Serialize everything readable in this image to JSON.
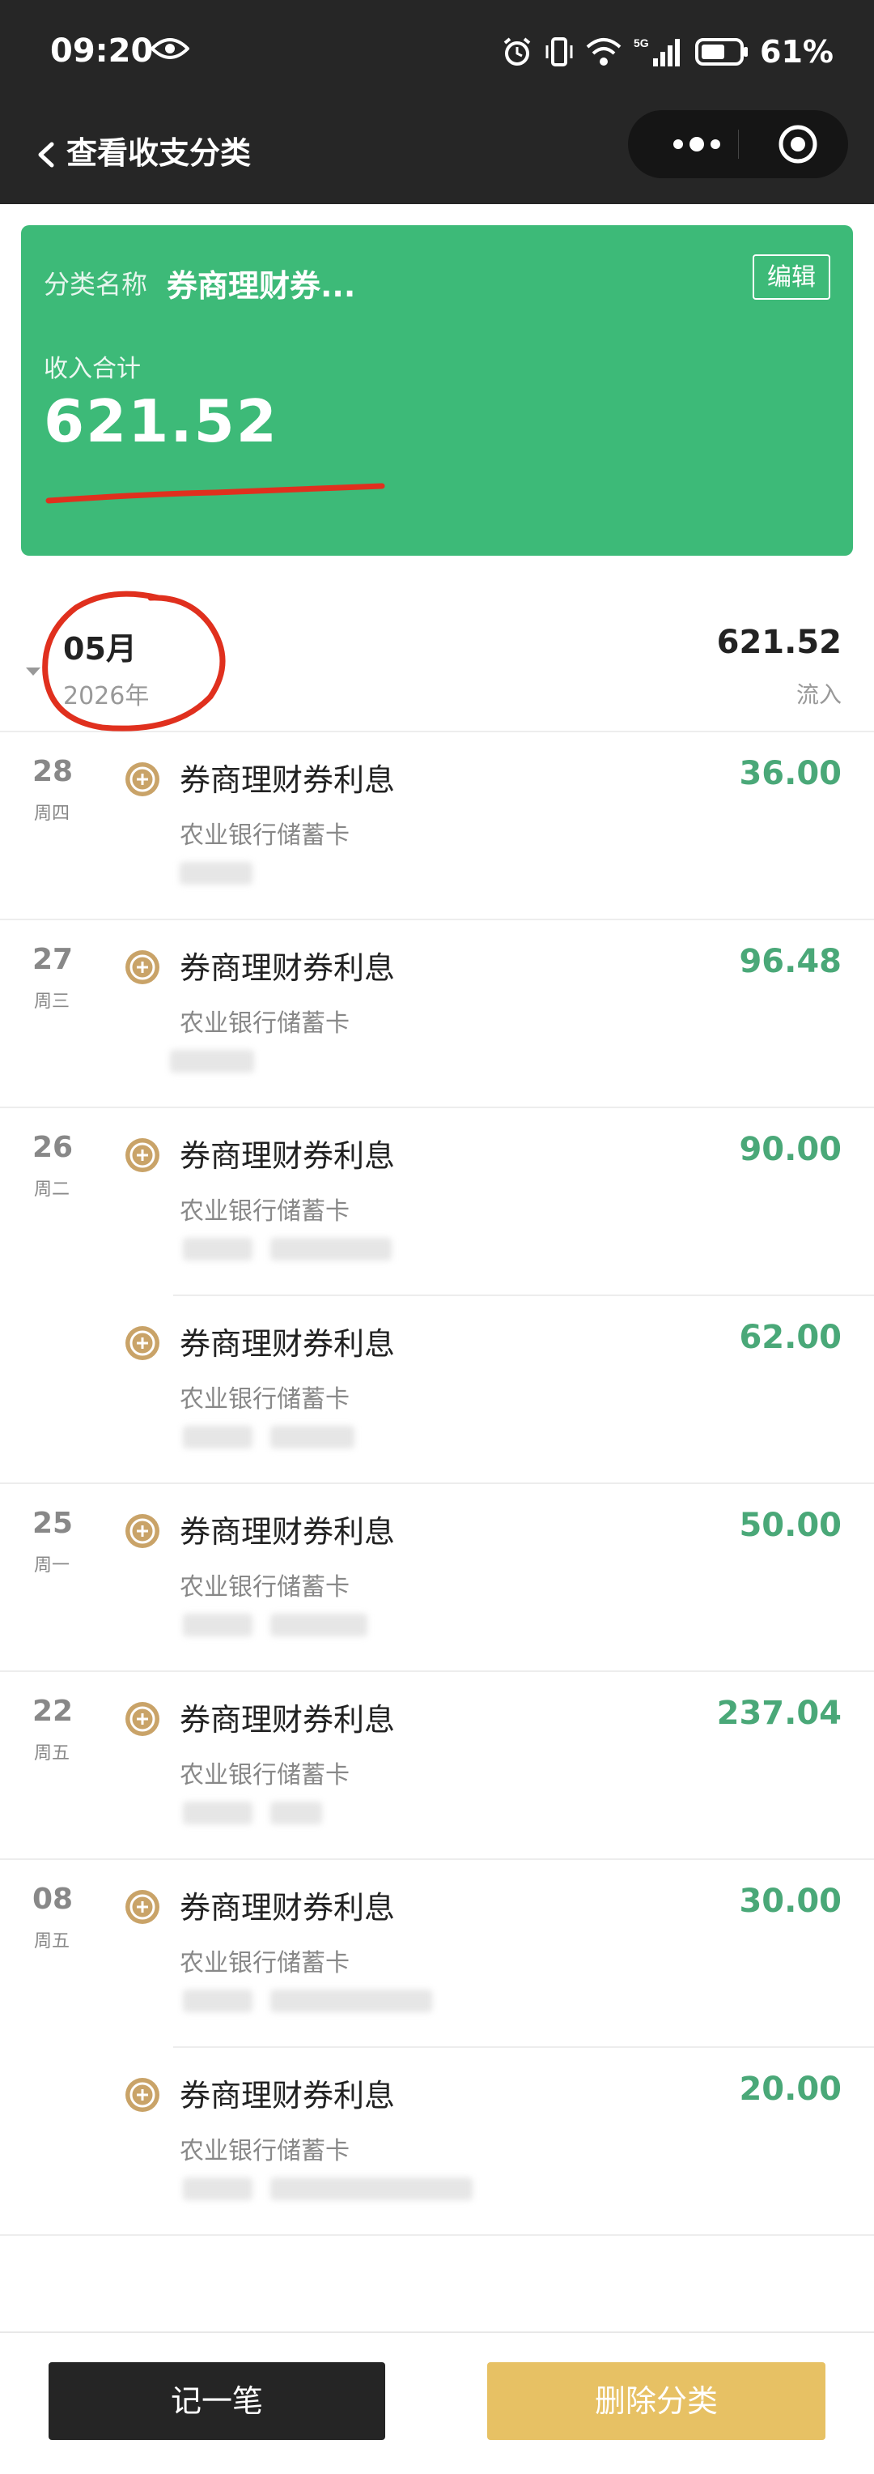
{
  "status_bar": {
    "time": "09:20",
    "battery_percent": "61%",
    "icons": [
      "eye-icon",
      "alarm-icon",
      "vibrate-icon",
      "wifi-icon",
      "5g-signal-icon",
      "battery-icon"
    ]
  },
  "nav": {
    "back_icon": "chevron-left-icon",
    "title": "查看收支分类",
    "capsule_icons": [
      "more-dots-icon",
      "target-circle-icon"
    ]
  },
  "card": {
    "category_label": "分类名称",
    "category_name": "券商理财券...",
    "edit_label": "编辑",
    "sum_label": "收入合计",
    "sum_value": "621.52",
    "colors": {
      "background": "#3dba78",
      "annotation": "#e0301e"
    }
  },
  "month": {
    "month_label": "05月",
    "year_label": "2026年",
    "total": "621.52",
    "flow_label": "流入"
  },
  "transactions": [
    {
      "day": "28",
      "weekday": "周四",
      "title": "券商理财券利息",
      "account": "农业银行储蓄卡",
      "amount": "36.00"
    },
    {
      "day": "27",
      "weekday": "周三",
      "title": "券商理财券利息",
      "account": "农业银行储蓄卡",
      "amount": "96.48"
    },
    {
      "day": "26",
      "weekday": "周二",
      "title": "券商理财券利息",
      "account": "农业银行储蓄卡",
      "amount": "90.00"
    },
    {
      "day": "",
      "weekday": "",
      "title": "券商理财券利息",
      "account": "农业银行储蓄卡",
      "amount": "62.00"
    },
    {
      "day": "25",
      "weekday": "周一",
      "title": "券商理财券利息",
      "account": "农业银行储蓄卡",
      "amount": "50.00"
    },
    {
      "day": "22",
      "weekday": "周五",
      "title": "券商理财券利息",
      "account": "农业银行储蓄卡",
      "amount": "237.04"
    },
    {
      "day": "08",
      "weekday": "周五",
      "title": "券商理财券利息",
      "account": "农业银行储蓄卡",
      "amount": "30.00"
    },
    {
      "day": "",
      "weekday": "",
      "title": "券商理财券利息",
      "account": "农业银行储蓄卡",
      "amount": "20.00"
    }
  ],
  "transaction_icon": "coin-icon",
  "amount_color": "#4aa878",
  "buttons": {
    "record_label": "记一笔",
    "delete_label": "删除分类"
  }
}
